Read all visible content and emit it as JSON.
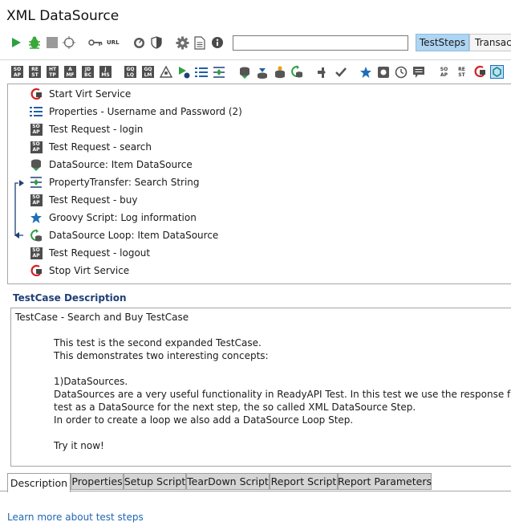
{
  "window": {
    "title": "XML DataSource"
  },
  "toolbar": {
    "url_label": "URL",
    "search_value": "",
    "tabs": [
      {
        "label": "TestSteps",
        "active": true
      },
      {
        "label": "Transacti",
        "active": false
      }
    ]
  },
  "steps_toolbar": {
    "soap_icons": [
      [
        "SO",
        "AP"
      ],
      [
        "RE",
        "ST"
      ],
      [
        "HT",
        "TP"
      ],
      [
        "A",
        "MF"
      ],
      [
        "JD",
        "BC"
      ],
      [
        "J",
        "MS"
      ],
      [
        "GQ",
        "LQ"
      ],
      [
        "GQ",
        "LM"
      ]
    ],
    "soap_icons_right": [
      [
        "SO",
        "AP"
      ],
      [
        "RE",
        "ST"
      ]
    ]
  },
  "steps": [
    {
      "label": "Start Virt Service",
      "icon": "virt-service-icon"
    },
    {
      "label": "Properties - Username and Password (2)",
      "icon": "properties-icon"
    },
    {
      "label": "Test Request - login",
      "icon": "soap-request-icon",
      "badge": [
        "SO",
        "AP"
      ]
    },
    {
      "label": "Test Request - search",
      "icon": "soap-request-icon",
      "badge": [
        "SO",
        "AP"
      ]
    },
    {
      "label": "DataSource: Item DataSource",
      "icon": "datasource-icon"
    },
    {
      "label": "PropertyTransfer: Search String",
      "icon": "property-transfer-icon"
    },
    {
      "label": "Test Request - buy",
      "icon": "soap-request-icon",
      "badge": [
        "SO",
        "AP"
      ]
    },
    {
      "label": "Groovy Script: Log information",
      "icon": "groovy-star-icon"
    },
    {
      "label": "DataSource Loop: Item DataSource",
      "icon": "datasource-loop-icon"
    },
    {
      "label": "Test Request - logout",
      "icon": "soap-request-icon",
      "badge": [
        "SO",
        "AP"
      ]
    },
    {
      "label": "Stop Virt Service",
      "icon": "virt-service-icon"
    }
  ],
  "description": {
    "header": "TestCase Description",
    "lines": [
      "TestCase - Search and Buy TestCase",
      "This test is the second expanded TestCase.",
      "This demonstrates two interesting concepts:",
      "1)DataSources.",
      "DataSources are a very useful functionality in ReadyAPI Test. In this test we use the response from a previous",
      "test as a DataSource for the next step, the so called XML DataSource Step.",
      "In order to create a loop we also add a DataSource Loop Step.",
      "Try it now!"
    ]
  },
  "bottom_tabs": [
    {
      "label": "Description",
      "active": true
    },
    {
      "label": "Properties",
      "active": false
    },
    {
      "label": "Setup Script",
      "active": false
    },
    {
      "label": "TearDown Script",
      "active": false
    },
    {
      "label": "Report Script",
      "active": false
    },
    {
      "label": "Report Parameters",
      "active": false
    }
  ],
  "footer": {
    "link": "Learn more about test steps"
  },
  "colors": {
    "accent_tab": "#aed5f2",
    "link": "#1f66b5",
    "header": "#1f3f77",
    "run_green": "#2ea043"
  }
}
